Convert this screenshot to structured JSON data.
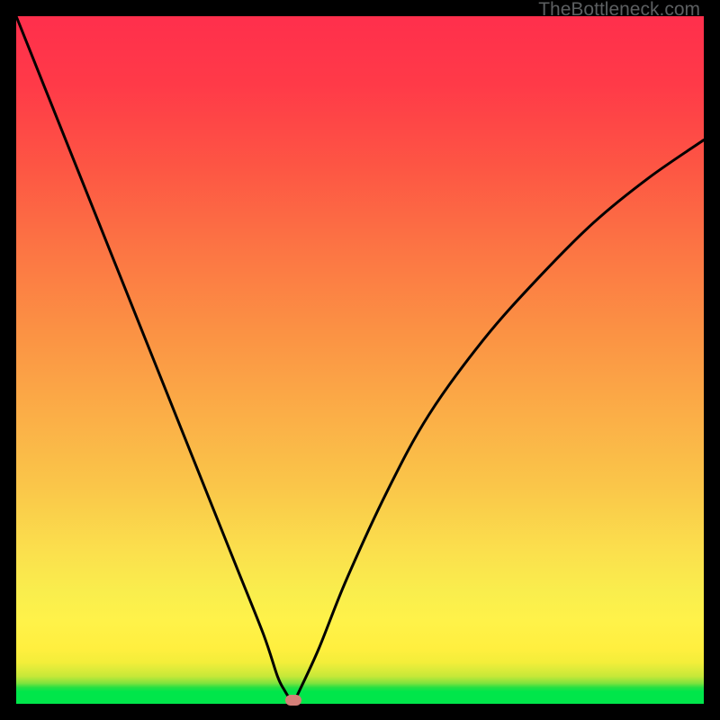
{
  "watermark": {
    "text": "TheBottleneck.com"
  },
  "colors": {
    "frame": "#000000",
    "curve": "#000000",
    "marker": "#d47f78",
    "gradient_top": "#ff2f4c",
    "gradient_bottom": "#00e64a"
  },
  "chart_data": {
    "type": "line",
    "title": "",
    "xlabel": "",
    "ylabel": "",
    "xlim": [
      0,
      100
    ],
    "ylim": [
      0,
      100
    ],
    "series": [
      {
        "name": "bottleneck-curve",
        "x": [
          0,
          4,
          8,
          12,
          16,
          20,
          24,
          28,
          32,
          36,
          38,
          39,
          40,
          40.5,
          41,
          44,
          48,
          54,
          60,
          68,
          76,
          84,
          92,
          100
        ],
        "values": [
          100,
          90,
          80,
          70,
          60,
          50,
          40,
          30,
          20,
          10,
          4,
          2,
          0.5,
          0.5,
          1.5,
          8,
          18,
          31,
          42,
          53,
          62,
          70,
          76.5,
          82
        ]
      }
    ],
    "marker": {
      "x": 40.3,
      "y": 0.5,
      "shape": "pill"
    }
  }
}
